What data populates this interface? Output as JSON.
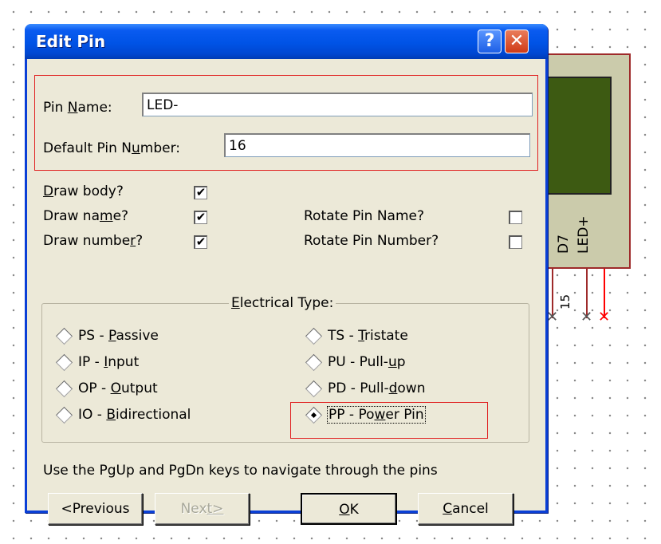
{
  "dialog": {
    "title": "Edit Pin",
    "help_button": "?",
    "close_button": "✕"
  },
  "pin_name": {
    "label_pre": "Pin ",
    "label_key": "N",
    "label_post": "ame:",
    "value": "LED-"
  },
  "pin_number": {
    "label_pre": "Default Pin N",
    "label_key": "u",
    "label_post": "mber:",
    "value": "16"
  },
  "checkboxes": [
    {
      "pre": "",
      "key": "D",
      "post": "raw body?",
      "checked": "✔"
    },
    {
      "pre": "Draw na",
      "key": "m",
      "post": "e?",
      "checked": "✔"
    },
    {
      "pre": "Draw numbe",
      "key": "r",
      "post": "?",
      "checked": "✔"
    },
    {
      "pre": "Rotate Pin Name?",
      "key": "",
      "post": "",
      "checked": ""
    },
    {
      "pre": "Rotate Pin Number?",
      "key": "",
      "post": "",
      "checked": ""
    }
  ],
  "electrical_type": {
    "title_key": "E",
    "title_post": "lectrical Type:",
    "options": [
      {
        "pre": "PS - ",
        "key": "P",
        "post": "assive",
        "selected": false
      },
      {
        "pre": "IP - ",
        "key": "I",
        "post": "nput",
        "selected": false
      },
      {
        "pre": "OP - ",
        "key": "O",
        "post": "utput",
        "selected": false
      },
      {
        "pre": "IO - ",
        "key": "B",
        "post": "idirectional",
        "selected": false
      },
      {
        "pre": "TS - ",
        "key": "T",
        "post": "ristate",
        "selected": false
      },
      {
        "pre": "PU - Pull-",
        "key": "u",
        "post": "p",
        "selected": false
      },
      {
        "pre": "PD - Pull-",
        "key": "d",
        "post": "own",
        "selected": false
      },
      {
        "pre": "PP - Po",
        "key": "w",
        "post": "er Pin",
        "selected": true
      }
    ]
  },
  "hint": "Use the PgUp and PgDn keys to navigate through the pins",
  "buttons": {
    "previous": "<Previous",
    "next_pre": "Nex",
    "next_key": "t>",
    "ok_key": "O",
    "ok_post": "K",
    "cancel_key": "C",
    "cancel_post": "ancel"
  },
  "schematic": {
    "pin_labels": [
      "D7",
      "LED+"
    ],
    "pin_number": "15",
    "x_marks": [
      "✕",
      "✕",
      "✕"
    ]
  },
  "colors": {
    "title_bar": "#0053e6",
    "dialog_bg": "#ece9d8",
    "highlight_box": "#e02020",
    "chip_fill": "#cbcbab",
    "lcd_fill": "#3d5a12",
    "power_wire": "#ff0000"
  }
}
